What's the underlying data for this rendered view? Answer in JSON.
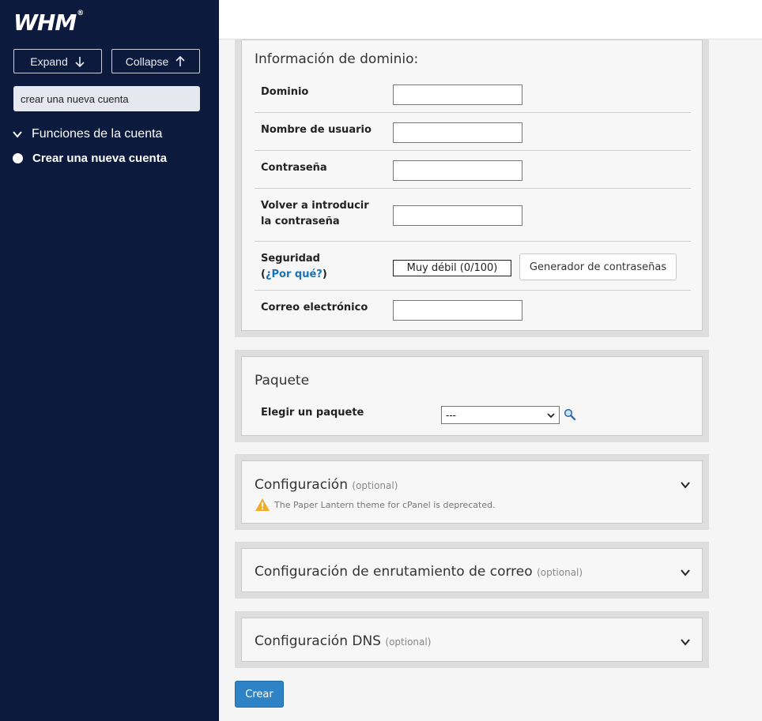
{
  "sidebar": {
    "logo": "WHM",
    "logo_mark": "®",
    "expand_label": "Expand",
    "collapse_label": "Collapse",
    "search_value": "crear una nueva cuenta",
    "category": "Funciones de la cuenta",
    "item": "Crear una nueva cuenta"
  },
  "domain_info": {
    "title": "Información de dominio:",
    "domain_label": "Dominio",
    "username_label": "Nombre de usuario",
    "password_label": "Contraseña",
    "reenter_line1": "Volver a introducir",
    "reenter_line2": "la contraseña",
    "security_label": "Seguridad",
    "why_prefix": "(",
    "why_link": "¿Por qué?",
    "why_suffix": ")",
    "strength_text": "Muy débil (0/100)",
    "generator_label": "Generador de contraseñas",
    "email_label": "Correo electrónico"
  },
  "package": {
    "title": "Paquete",
    "choose_label": "Elegir un paquete",
    "selected": "---"
  },
  "settings": {
    "title": "Configuración",
    "optional": "(optional)",
    "warning": "The Paper Lantern theme for cPanel is deprecated."
  },
  "mail_routing": {
    "title": "Configuración de enrutamiento de correo",
    "optional": "(optional)"
  },
  "dns": {
    "title": "Configuración DNS",
    "optional": "(optional)"
  },
  "create_label": "Crear",
  "colors": {
    "sidebar_bg": "#0c1a3e",
    "link": "#1b72b8",
    "primary_button": "#2d83c5",
    "warning": "#f0ad2a"
  }
}
